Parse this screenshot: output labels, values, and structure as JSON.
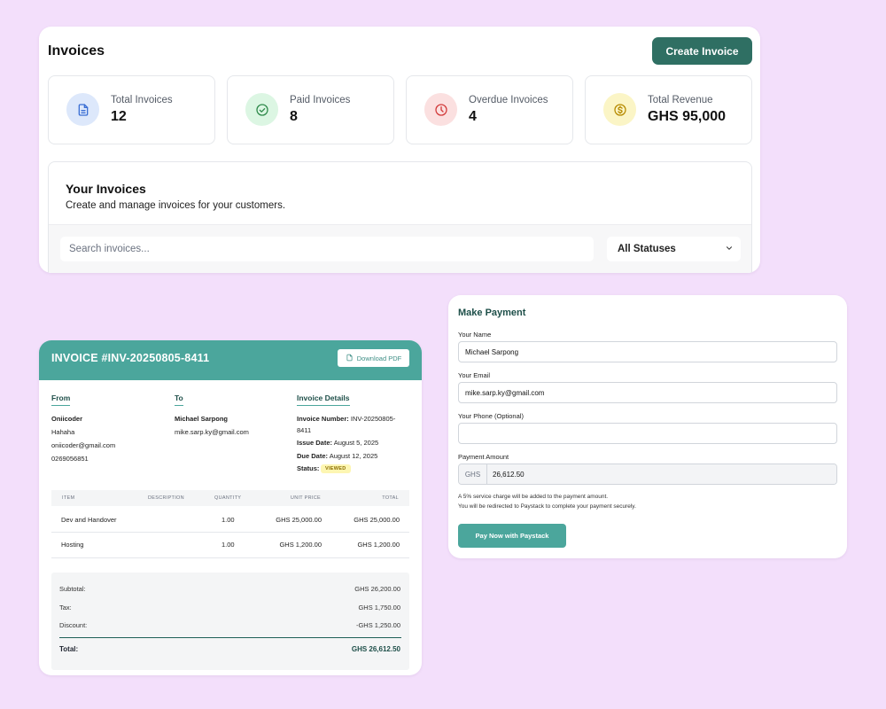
{
  "dashboard": {
    "title": "Invoices",
    "create_button": "Create Invoice",
    "stats": [
      {
        "label": "Total Invoices",
        "value": "12",
        "icon": "document-icon",
        "color": "#3b6fd4",
        "bg": "#dde8fb"
      },
      {
        "label": "Paid Invoices",
        "value": "8",
        "icon": "check-circle-icon",
        "color": "#2f8a4b",
        "bg": "#dcf6e3"
      },
      {
        "label": "Overdue Invoices",
        "value": "4",
        "icon": "clock-icon",
        "color": "#d23b3b",
        "bg": "#fbe0e0"
      },
      {
        "label": "Total Revenue",
        "value": "GHS 95,000",
        "icon": "dollar-circle-icon",
        "color": "#b68a00",
        "bg": "#fbf5c6"
      }
    ],
    "panel_title": "Your Invoices",
    "panel_subtitle": "Create and manage invoices for your customers.",
    "search_placeholder": "Search invoices...",
    "status_filter": "All Statuses"
  },
  "invoice": {
    "number": "INVOICE #INV-20250805-8411",
    "download_button": "Download PDF",
    "from": {
      "heading": "From",
      "name": "Oniicoder",
      "line2": "Hahaha",
      "email": "oniicoder@gmail.com",
      "phone": "0269056851"
    },
    "to": {
      "heading": "To",
      "name": "Michael Sarpong",
      "email": "mike.sarp.ky@gmail.com"
    },
    "details": {
      "heading": "Invoice Details",
      "number_label": "Invoice Number:",
      "number_value_1": "INV-20250805-",
      "number_value_2": "8411",
      "issue_label": "Issue Date:",
      "issue_value": "August 5, 2025",
      "due_label": "Due Date:",
      "due_value": "August 12, 2025",
      "status_label": "Status:",
      "status_value": "VIEWED"
    },
    "columns": [
      "ITEM",
      "DESCRIPTION",
      "QUANTITY",
      "UNIT PRICE",
      "TOTAL"
    ],
    "items": [
      {
        "item": "Dev and Handover",
        "description": "",
        "quantity": "1.00",
        "unit_price": "GHS 25,000.00",
        "total": "GHS 25,000.00"
      },
      {
        "item": "Hosting",
        "description": "",
        "quantity": "1.00",
        "unit_price": "GHS 1,200.00",
        "total": "GHS 1,200.00"
      }
    ],
    "totals": {
      "subtotal_label": "Subtotal:",
      "subtotal_value": "GHS 26,200.00",
      "tax_label": "Tax:",
      "tax_value": "GHS 1,750.00",
      "discount_label": "Discount:",
      "discount_value": "-GHS 1,250.00",
      "total_label": "Total:",
      "total_value": "GHS 26,612.50"
    }
  },
  "payment": {
    "title": "Make Payment",
    "name_label": "Your Name",
    "name_value": "Michael Sarpong",
    "email_label": "Your Email",
    "email_value": "mike.sarp.ky@gmail.com",
    "phone_label": "Your Phone (Optional)",
    "phone_value": "",
    "amount_label": "Payment Amount",
    "currency": "GHS",
    "amount_value": "26,612.50",
    "note_1": "A 5% service charge will be added to the payment amount.",
    "note_2": "You will be redirected to Paystack to complete your payment securely.",
    "pay_button": "Pay Now with Paystack"
  },
  "colors": {
    "accent_dark": "#2f6f63",
    "accent": "#4ba69c",
    "background": "#f3dffb"
  }
}
